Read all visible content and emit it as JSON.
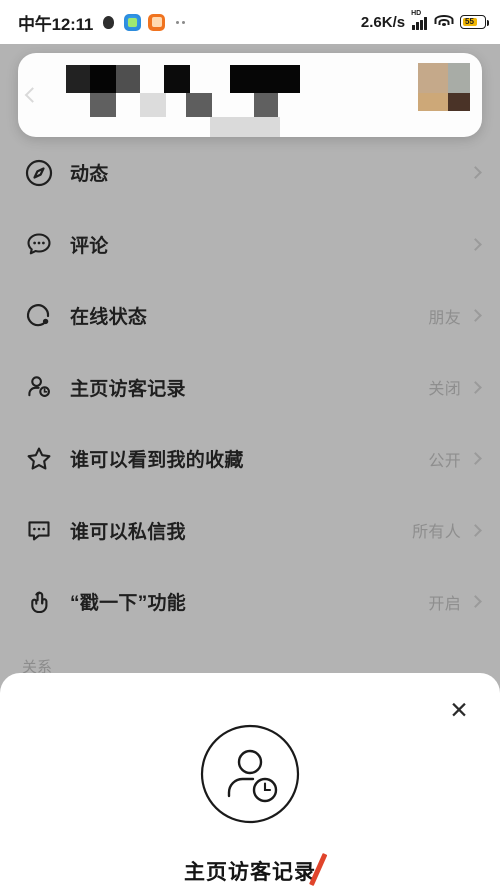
{
  "status_bar": {
    "time": "中午12:11",
    "app_icons": [
      "qq-icon",
      "blue-app-icon",
      "orange-app-icon"
    ],
    "overflow_dots": "··",
    "network_speed": "2.6K/s",
    "network_type": "HD",
    "signal_icon": "cellular-signal-icon",
    "wifi_icon": "wifi-icon",
    "battery_level": "55"
  },
  "top_card": {
    "back_icon": "back-chevron-icon",
    "censored": true,
    "thumbnail_colors": [
      "#c5a98a",
      "#a8aca6",
      "#cda878",
      "#4a3327"
    ]
  },
  "settings_list": {
    "rows": [
      {
        "icon": "compass-icon",
        "label": "动态",
        "value": ""
      },
      {
        "icon": "comment-bubble-icon",
        "label": "评论",
        "value": ""
      },
      {
        "icon": "online-status-icon",
        "label": "在线状态",
        "value": "朋友"
      },
      {
        "icon": "visitor-record-icon",
        "label": "主页访客记录",
        "value": "关闭"
      },
      {
        "icon": "star-icon",
        "label": "谁可以看到我的收藏",
        "value": "公开"
      },
      {
        "icon": "message-icon",
        "label": "谁可以私信我",
        "value": "所有人"
      },
      {
        "icon": "poke-hand-icon",
        "label": "“戳一下”功能",
        "value": "开启"
      }
    ],
    "section_label": "关系"
  },
  "bottom_sheet": {
    "close_icon": "close-icon",
    "hero_icon": "visitor-record-circle-icon",
    "title": "主页访客记录",
    "annotation_color": "#e0442b"
  }
}
